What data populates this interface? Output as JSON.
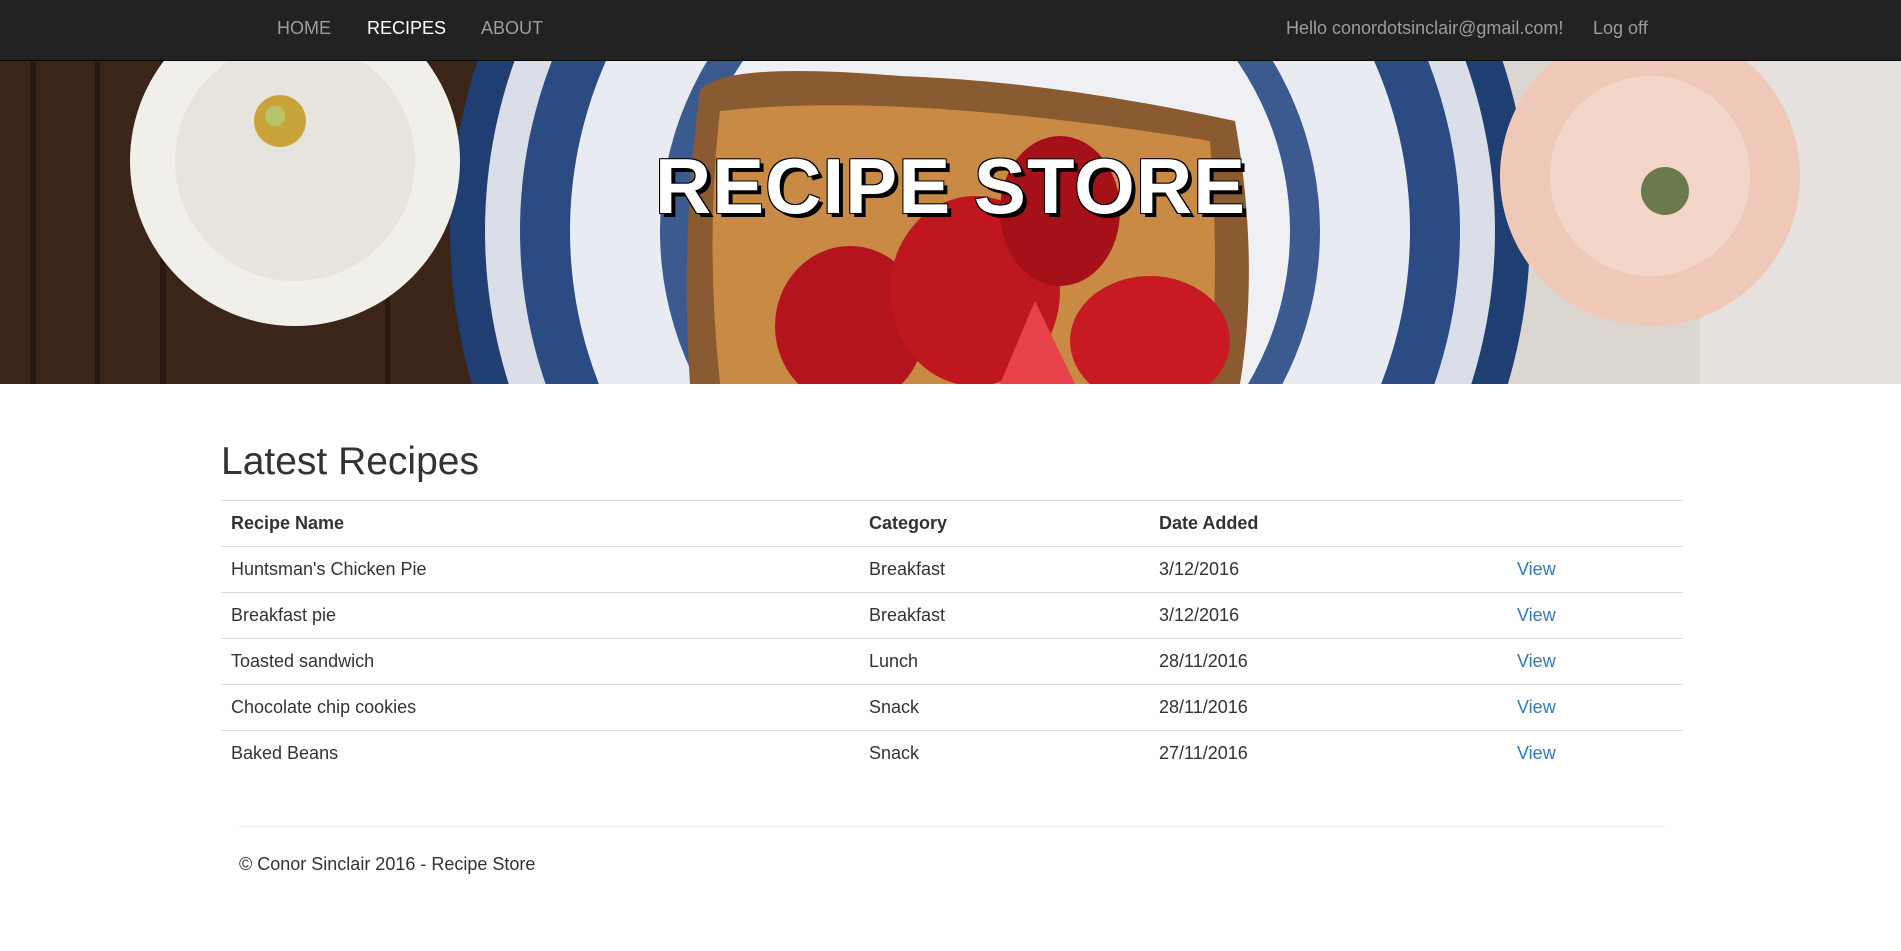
{
  "nav": {
    "home": "HOME",
    "recipes": "RECIPES",
    "about": "ABOUT",
    "hello": "Hello conordotsinclair@gmail.com!",
    "logoff": "Log off"
  },
  "hero": {
    "title": "RECIPE STORE"
  },
  "main": {
    "heading": "Latest Recipes",
    "columns": [
      "Recipe Name",
      "Category",
      "Date Added",
      ""
    ],
    "rows": [
      {
        "name": "Huntsman's Chicken Pie",
        "category": "Breakfast",
        "date": "3/12/2016",
        "action": "View"
      },
      {
        "name": "Breakfast pie",
        "category": "Breakfast",
        "date": "3/12/2016",
        "action": "View"
      },
      {
        "name": "Toasted sandwich",
        "category": "Lunch",
        "date": "28/11/2016",
        "action": "View"
      },
      {
        "name": "Chocolate chip cookies",
        "category": "Snack",
        "date": "28/11/2016",
        "action": "View"
      },
      {
        "name": "Baked Beans",
        "category": "Snack",
        "date": "27/11/2016",
        "action": "View"
      }
    ]
  },
  "footer": {
    "text": "© Conor Sinclair 2016 - Recipe Store"
  },
  "colors": {
    "navbar": "#222222",
    "nav_text": "#9d9d9d",
    "nav_active": "#ffffff",
    "link": "#337ab7"
  }
}
